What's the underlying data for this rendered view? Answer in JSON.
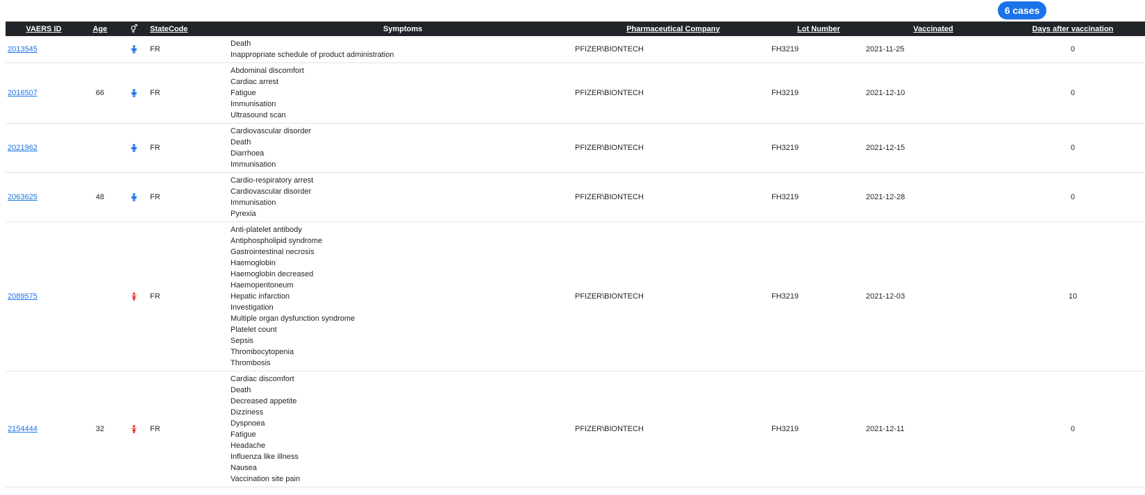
{
  "badge": "6 cases",
  "columns": {
    "id": "VAERS ID",
    "age": "Age",
    "sex": "⚥",
    "state": "StateCode",
    "symptoms": "Symptoms",
    "company": "Pharmaceutical Company",
    "lot": "Lot Number",
    "vaccinated": "Vaccinated",
    "days": "Days after vaccination"
  },
  "colors": {
    "male": "#1a73e8",
    "female": "#e53935",
    "link": "#1a73e8",
    "header_bg": "#212529"
  },
  "rows": [
    {
      "id": "2013545",
      "age": "",
      "sex": "male",
      "sex_icon": "male-person-icon",
      "state": "FR",
      "symptoms": [
        "Death",
        "Inappropriate schedule of product administration"
      ],
      "company": "PFIZER\\BIONTECH",
      "lot": "FH3219",
      "vaccinated": "2021-11-25",
      "days": "0"
    },
    {
      "id": "2016507",
      "age": "66",
      "sex": "male",
      "sex_icon": "male-person-icon",
      "state": "FR",
      "symptoms": [
        "Abdominal discomfort",
        "Cardiac arrest",
        "Fatigue",
        "Immunisation",
        "Ultrasound scan"
      ],
      "company": "PFIZER\\BIONTECH",
      "lot": "FH3219",
      "vaccinated": "2021-12-10",
      "days": "0"
    },
    {
      "id": "2021962",
      "age": "",
      "sex": "male",
      "sex_icon": "male-person-icon",
      "state": "FR",
      "symptoms": [
        "Cardiovascular disorder",
        "Death",
        "Diarrhoea",
        "Immunisation"
      ],
      "company": "PFIZER\\BIONTECH",
      "lot": "FH3219",
      "vaccinated": "2021-12-15",
      "days": "0"
    },
    {
      "id": "2063625",
      "age": "48",
      "sex": "male",
      "sex_icon": "male-person-icon",
      "state": "FR",
      "symptoms": [
        "Cardio-respiratory arrest",
        "Cardiovascular disorder",
        "Immunisation",
        "Pyrexia"
      ],
      "company": "PFIZER\\BIONTECH",
      "lot": "FH3219",
      "vaccinated": "2021-12-28",
      "days": "0"
    },
    {
      "id": "2089575",
      "age": "",
      "sex": "female",
      "sex_icon": "female-person-icon",
      "state": "FR",
      "symptoms": [
        "Anti-platelet antibody",
        "Antiphospholipid syndrome",
        "Gastrointestinal necrosis",
        "Haemoglobin",
        "Haemoglobin decreased",
        "Haemoperitoneum",
        "Hepatic infarction",
        "Investigation",
        "Multiple organ dysfunction syndrome",
        "Platelet count",
        "Sepsis",
        "Thrombocytopenia",
        "Thrombosis"
      ],
      "company": "PFIZER\\BIONTECH",
      "lot": "FH3219",
      "vaccinated": "2021-12-03",
      "days": "10"
    },
    {
      "id": "2154444",
      "age": "32",
      "sex": "female",
      "sex_icon": "female-person-icon",
      "state": "FR",
      "symptoms": [
        "Cardiac discomfort",
        "Death",
        "Decreased appetite",
        "Dizziness",
        "Dyspnoea",
        "Fatigue",
        "Headache",
        "Influenza like illness",
        "Nausea",
        "Vaccination site pain"
      ],
      "company": "PFIZER\\BIONTECH",
      "lot": "FH3219",
      "vaccinated": "2021-12-11",
      "days": "0"
    }
  ]
}
